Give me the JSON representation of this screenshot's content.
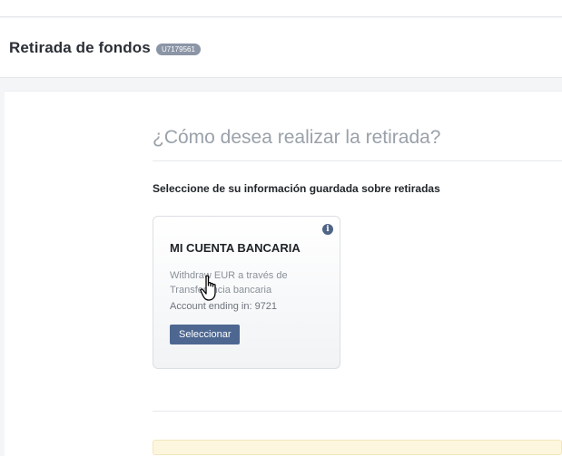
{
  "header": {
    "title": "Retirada de fondos",
    "account_badge": "U7179561"
  },
  "main": {
    "question": "¿Cómo desea realizar la retirada?",
    "subtitle": "Seleccione de su información guardada sobre retiradas",
    "card": {
      "info_icon": "info-icon",
      "title": "MI CUENTA BANCARIA",
      "description": "Withdraw EUR a través de Transferencia bancaria",
      "account": "Account ending in: 9721",
      "select_label": "Seleccionar"
    }
  },
  "colors": {
    "badge": "#8b95a6",
    "button": "#4d6791",
    "info_icon": "#4f6487",
    "notice": "#fdf6df"
  }
}
